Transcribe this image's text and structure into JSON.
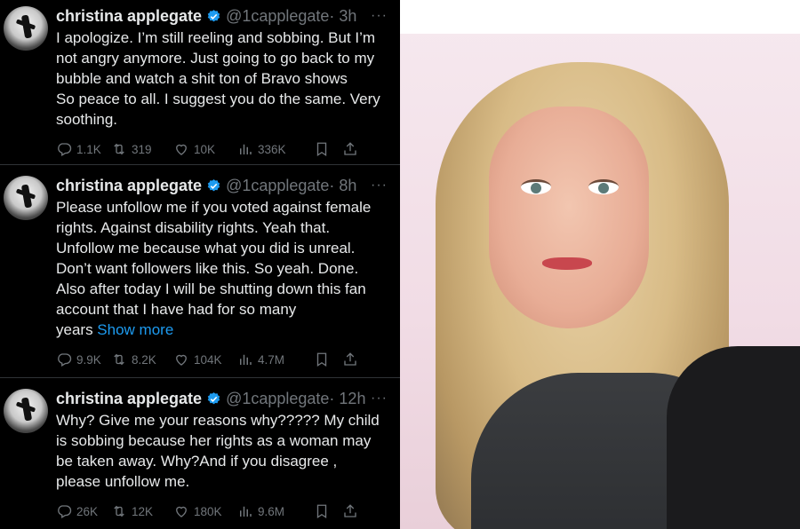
{
  "tweets": [
    {
      "name": "christina applegate",
      "handle": "@1capplegate",
      "time": "· 3h",
      "text": "I apologize. I’m still reeling and sobbing. But I’m\nnot angry anymore. Just going to go back to my\nbubble and watch a shit ton of Bravo shows\nSo peace to all. I suggest you do the same. Very\nsoothing.",
      "show_more": "",
      "replies": "1.1K",
      "retweets": "319",
      "likes": "10K",
      "views": "336K"
    },
    {
      "name": "christina applegate",
      "handle": "@1capplegate",
      "time": "· 8h",
      "text": "Please unfollow me if you voted against female\nrights. Against disability rights. Yeah that.\nUnfollow me because what you did is unreal.\nDon’t want followers like this. So yeah. Done.\nAlso after today I will be shutting down this fan\naccount that I have had for so many\nyears ",
      "show_more": "Show more",
      "replies": "9.9K",
      "retweets": "8.2K",
      "likes": "104K",
      "views": "4.7M"
    },
    {
      "name": "christina applegate",
      "handle": "@1capplegate",
      "time": "· 12h",
      "text": "Why? Give me your reasons why????? My child\nis sobbing because her rights as a woman may\nbe taken away. Why?And if you disagree ,\nplease unfollow me.",
      "show_more": "",
      "replies": "26K",
      "retweets": "12K",
      "likes": "180K",
      "views": "9.6M"
    }
  ],
  "more_glyph": "···",
  "colors": {
    "background": "#000000",
    "text": "#e7e9ea",
    "muted": "#71767b",
    "link": "#1d9bf0",
    "verified": "#1d9bf0"
  }
}
